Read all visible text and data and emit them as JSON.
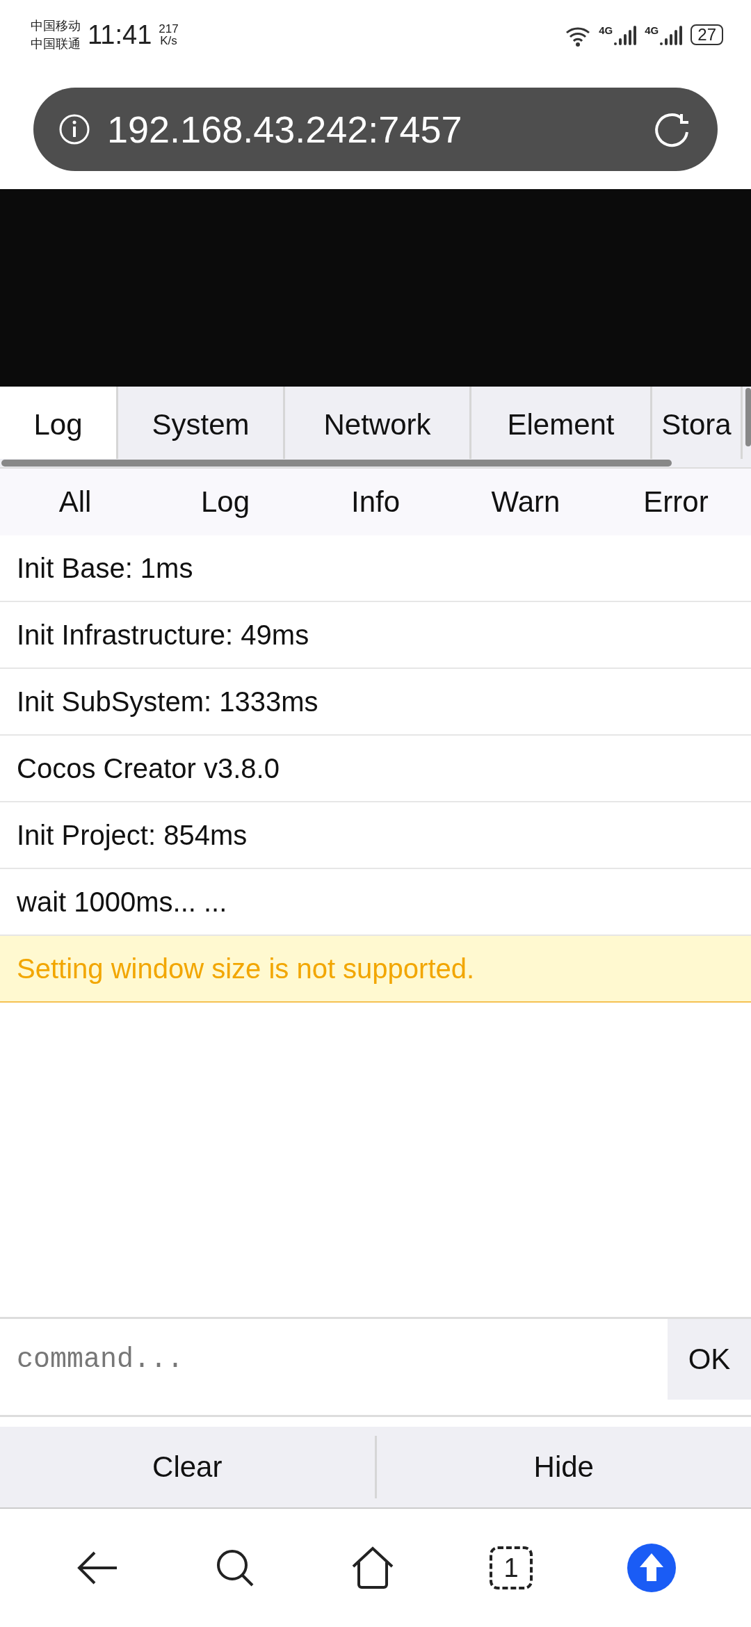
{
  "status_bar": {
    "carriers": [
      "中国移动",
      "中国联通"
    ],
    "time": "11:41",
    "speed": [
      "217",
      "K/s"
    ],
    "signals": [
      "4G",
      "4G"
    ],
    "battery": "27"
  },
  "address_bar": {
    "url": "192.168.43.242:7457"
  },
  "tabs": [
    {
      "label": "Log",
      "selected": true
    },
    {
      "label": "System",
      "selected": false
    },
    {
      "label": "Network",
      "selected": false
    },
    {
      "label": "Element",
      "selected": false
    },
    {
      "label": "Stora",
      "selected": false
    }
  ],
  "filters": [
    "All",
    "Log",
    "Info",
    "Warn",
    "Error"
  ],
  "logs": [
    {
      "kind": "log",
      "text": "Init Base: 1ms"
    },
    {
      "kind": "log",
      "text": "Init Infrastructure: 49ms"
    },
    {
      "kind": "log",
      "text": "Init SubSystem: 1333ms"
    },
    {
      "kind": "log",
      "text": "Cocos Creator v3.8.0"
    },
    {
      "kind": "log",
      "text": "Init Project: 854ms"
    },
    {
      "kind": "log",
      "text": "wait 1000ms... ..."
    },
    {
      "kind": "warn",
      "text": "Setting window size is not supported."
    }
  ],
  "command": {
    "placeholder": "command...",
    "button": "OK"
  },
  "actions": [
    "Clear",
    "Hide"
  ],
  "nav": {
    "tab_count": "1"
  }
}
